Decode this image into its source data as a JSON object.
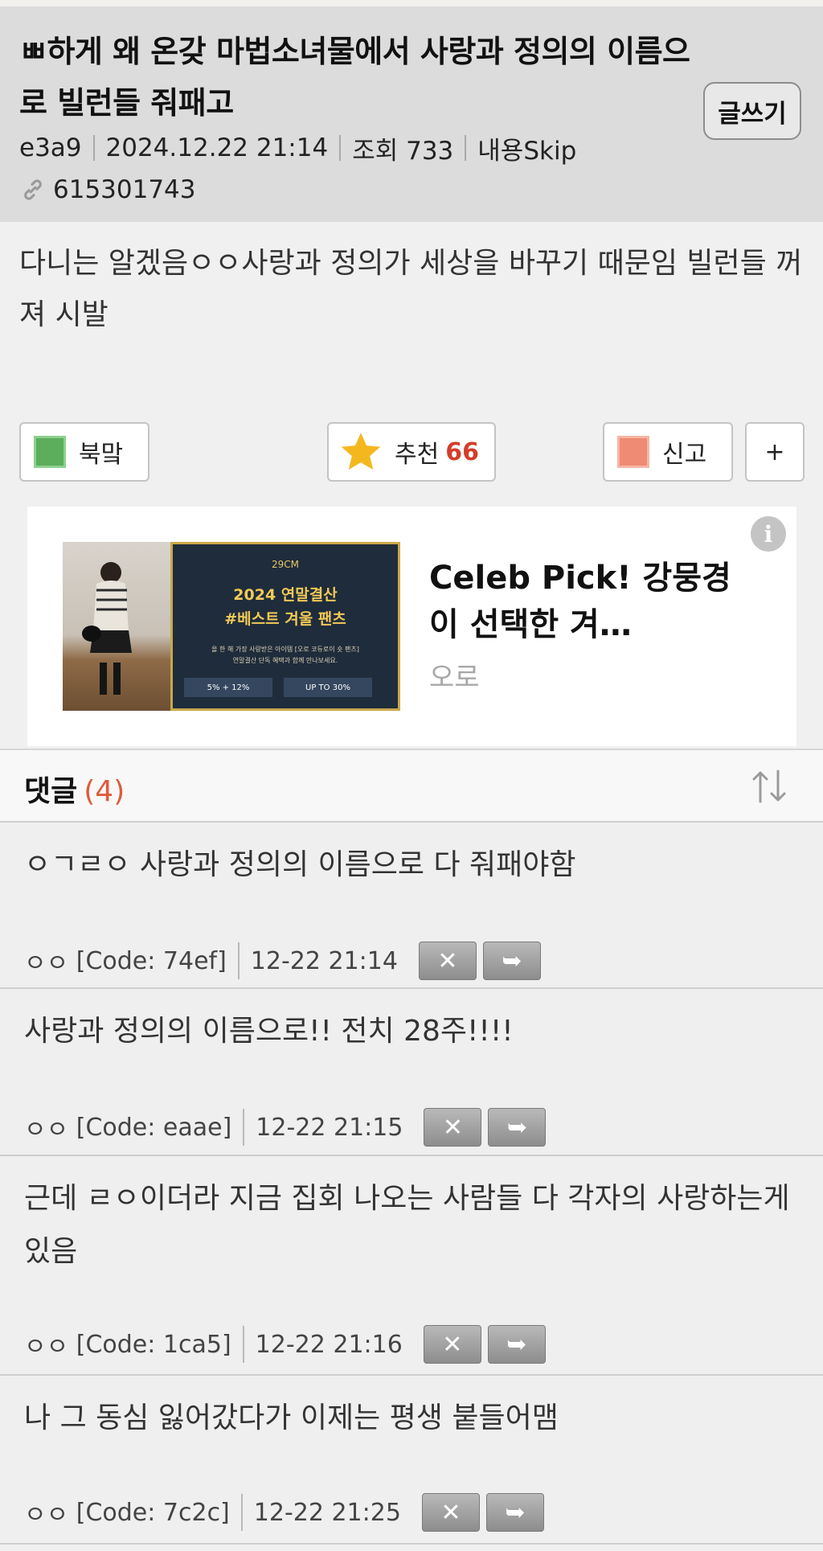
{
  "post": {
    "title": "ㅃ하게 왜 온갖 마법소녀물에서 사랑과 정의의 이름으로 빌런들 줘패고",
    "write_button": "글쓰기",
    "author": "e3a9",
    "date": "2024.12.22 21:14",
    "views": "조회 733",
    "skip": "내용Skip",
    "post_id": "615301743",
    "body": "다니는 알겠음ㅇㅇ사랑과 정의가 세상을 바꾸기 때문임 빌런들 꺼져 시발"
  },
  "actions": {
    "bookmark_label": "북맠",
    "recommend_label": "추천",
    "recommend_count": "66",
    "report_label": "신고",
    "more_label": "+"
  },
  "ad": {
    "title": "Celeb Pick! 강뭉경이 선택한 겨…",
    "brand": "오로",
    "banner_brand": "29CM",
    "banner_headline_1": "2024 연말결산",
    "banner_headline_2": "#베스트 겨울 팬츠",
    "banner_sub_1": "올 한 해 가장 사랑받은 아이템 [오로 코듀로이 숏 팬츠]",
    "banner_sub_2": "연말결산 단독 혜택과 함께 만나보세요.",
    "banner_pill_1": "5% + 12%",
    "banner_pill_2": "UP TO 30%",
    "info_label": "i"
  },
  "comments_header": {
    "label": "댓글",
    "count": "(4)"
  },
  "comments": [
    {
      "text": "ㅇㄱㄹㅇ 사랑과 정의의 이름으로 다 줘패야함",
      "author": "ㅇㅇ",
      "code": "[Code: 74ef]",
      "time": "12-22 21:14"
    },
    {
      "text": "사랑과 정의의 이름으로!! 전치 28주!!!!",
      "author": "ㅇㅇ",
      "code": "[Code: eaae]",
      "time": "12-22 21:15"
    },
    {
      "text": "근데 ㄹㅇ이더라 지금 집회 나오는 사람들 다 각자의 사랑하는게 있음",
      "author": "ㅇㅇ",
      "code": "[Code: 1ca5]",
      "time": "12-22 21:16"
    },
    {
      "text": "나 그 동심 잃어갔다가 이제는 평생 붙들어맴",
      "author": "ㅇㅇ",
      "code": "[Code: 7c2c]",
      "time": "12-22 21:25"
    }
  ],
  "colors": {
    "header_bg": "#dcdcdc",
    "accent_red": "#d43d2a",
    "bookmark_green": "#5cad5c",
    "report_salmon": "#ef8a75",
    "star_yellow": "#f4b81e"
  }
}
